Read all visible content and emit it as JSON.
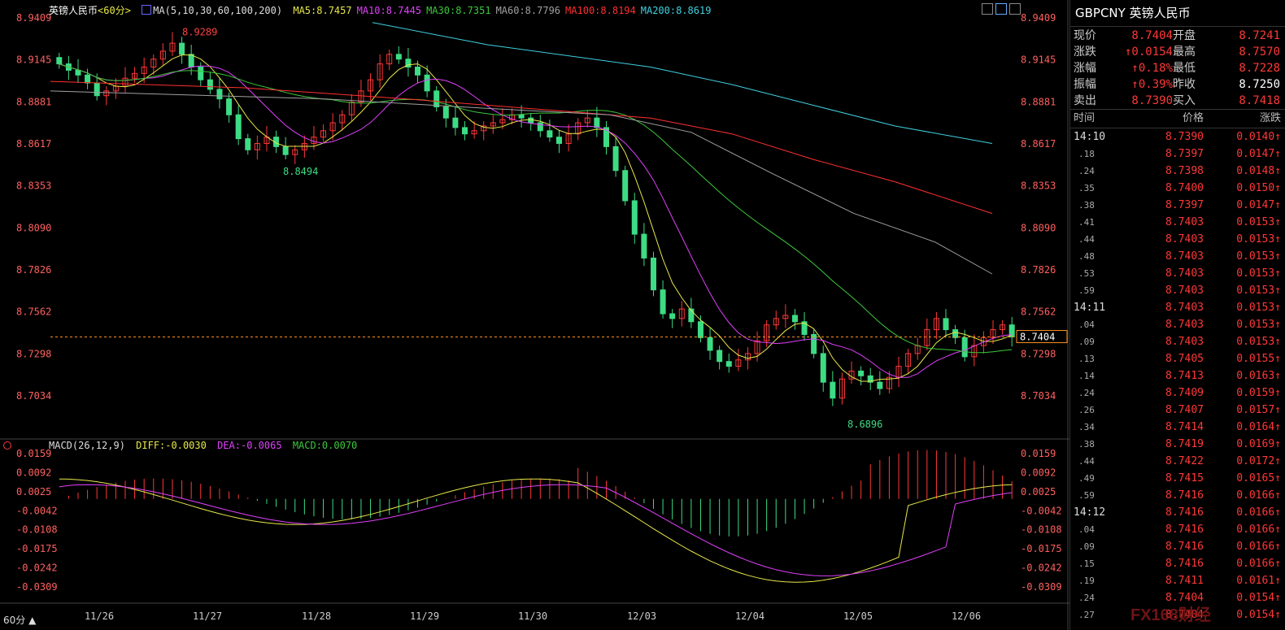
{
  "header": {
    "symbol_name": "英镑人民币",
    "period": "<60分>",
    "ma_icon": "chart-icon",
    "ma_label": "MA(5,10,30,60,100,200)",
    "ma_values": [
      {
        "text": "MA5:8.7457",
        "color": "#e8e84a"
      },
      {
        "text": "MA10:8.7445",
        "color": "#e040fb"
      },
      {
        "text": "MA30:8.7351",
        "color": "#3cc83c"
      },
      {
        "text": "MA60:8.7796",
        "color": "#a0a0a0"
      },
      {
        "text": "MA100:8.8194",
        "color": "#ff3030"
      },
      {
        "text": "MA200:8.8619",
        "color": "#40d0e0"
      }
    ]
  },
  "macd_header": {
    "label": "MACD(26,12,9)",
    "diff": "DIFF:-0.0030",
    "dea": "DEA:-0.0065",
    "macd": "MACD:0.0070"
  },
  "price_axis": [
    "8.9409",
    "8.9145",
    "8.8881",
    "8.8617",
    "8.8353",
    "8.8090",
    "8.7826",
    "8.7562",
    "8.7298",
    "8.7034"
  ],
  "current_price_tag": "8.7404",
  "macd_axis": [
    "0.0159",
    "0.0092",
    "0.0025",
    "-0.0042",
    "-0.0108",
    "-0.0175",
    "-0.0242",
    "-0.0309"
  ],
  "dates": [
    "11/26",
    "11/27",
    "11/28",
    "11/29",
    "11/30",
    "12/03",
    "12/04",
    "12/05",
    "12/06"
  ],
  "annotations": {
    "high": "8.9289",
    "low1": "8.8494",
    "low2": "8.6896"
  },
  "period_selector": "60分 ▲",
  "colors": {
    "up": "#ff3838",
    "down": "#3ddc84",
    "bg": "#000000",
    "grid": "#222222"
  },
  "panel": {
    "title": "GBPCNY 英镑人民币",
    "quote": [
      {
        "label": "现价",
        "value": "8.7404",
        "label2": "开盘",
        "value2": "8.7241"
      },
      {
        "label": "涨跌",
        "value": "↑0.0154",
        "label2": "最高",
        "value2": "8.7570"
      },
      {
        "label": "涨幅",
        "value": "↑0.18%",
        "label2": "最低",
        "value2": "8.7228"
      },
      {
        "label": "振幅",
        "value": "↑0.39%",
        "label2": "昨收",
        "value2": "8.7250"
      },
      {
        "label": "卖出",
        "value": "8.7390",
        "label2": "买入",
        "value2": "8.7418"
      }
    ],
    "ticks_header": {
      "time": "时间",
      "price": "价格",
      "change": "涨跌"
    },
    "ticks": [
      {
        "t": "14:10",
        "p": "8.7390",
        "c": "0.0140↑"
      },
      {
        "t": ".18",
        "p": "8.7397",
        "c": "0.0147↑"
      },
      {
        "t": ".24",
        "p": "8.7398",
        "c": "0.0148↑"
      },
      {
        "t": ".35",
        "p": "8.7400",
        "c": "0.0150↑"
      },
      {
        "t": ".38",
        "p": "8.7397",
        "c": "0.0147↑"
      },
      {
        "t": ".41",
        "p": "8.7403",
        "c": "0.0153↑"
      },
      {
        "t": ".44",
        "p": "8.7403",
        "c": "0.0153↑"
      },
      {
        "t": ".48",
        "p": "8.7403",
        "c": "0.0153↑"
      },
      {
        "t": ".53",
        "p": "8.7403",
        "c": "0.0153↑"
      },
      {
        "t": ".59",
        "p": "8.7403",
        "c": "0.0153↑"
      },
      {
        "t": "14:11",
        "p": "8.7403",
        "c": "0.0153↑"
      },
      {
        "t": ".04",
        "p": "8.7403",
        "c": "0.0153↑"
      },
      {
        "t": ".09",
        "p": "8.7403",
        "c": "0.0153↑"
      },
      {
        "t": ".13",
        "p": "8.7405",
        "c": "0.0155↑"
      },
      {
        "t": ".14",
        "p": "8.7413",
        "c": "0.0163↑"
      },
      {
        "t": ".24",
        "p": "8.7409",
        "c": "0.0159↑"
      },
      {
        "t": ".26",
        "p": "8.7407",
        "c": "0.0157↑"
      },
      {
        "t": ".34",
        "p": "8.7414",
        "c": "0.0164↑"
      },
      {
        "t": ".38",
        "p": "8.7419",
        "c": "0.0169↑"
      },
      {
        "t": ".44",
        "p": "8.7422",
        "c": "0.0172↑"
      },
      {
        "t": ".49",
        "p": "8.7415",
        "c": "0.0165↑"
      },
      {
        "t": ".59",
        "p": "8.7416",
        "c": "0.0166↑"
      },
      {
        "t": "14:12",
        "p": "8.7416",
        "c": "0.0166↑"
      },
      {
        "t": ".04",
        "p": "8.7416",
        "c": "0.0166↑"
      },
      {
        "t": ".09",
        "p": "8.7416",
        "c": "0.0166↑"
      },
      {
        "t": ".15",
        "p": "8.7416",
        "c": "0.0166↑"
      },
      {
        "t": ".19",
        "p": "8.7411",
        "c": "0.0161↑"
      },
      {
        "t": ".24",
        "p": "8.7404",
        "c": "0.0154↑"
      },
      {
        "t": ".27",
        "p": "8.7404",
        "c": "0.0154↑"
      }
    ]
  },
  "watermark": "FX168财经",
  "chart_data": {
    "type": "candlestick",
    "title": "英镑人民币 60分",
    "ylim": [
      8.6896,
      8.9409
    ],
    "x": [
      "11/26",
      "11/27",
      "11/28",
      "11/29",
      "11/30",
      "12/03",
      "12/04",
      "12/05",
      "12/06"
    ],
    "high": 8.9289,
    "low": 8.6896,
    "last": 8.7404,
    "ma": {
      "MA5": 8.7457,
      "MA10": 8.7445,
      "MA30": 8.7351,
      "MA60": 8.7796,
      "MA100": 8.8194,
      "MA200": 8.8619
    },
    "macd": {
      "DIFF": -0.003,
      "DEA": -0.0065,
      "MACD": 0.007,
      "ylim": [
        -0.0309,
        0.0159
      ]
    },
    "closes": [
      8.912,
      8.908,
      8.905,
      8.9,
      8.892,
      8.895,
      8.898,
      8.903,
      8.906,
      8.91,
      8.915,
      8.92,
      8.925,
      8.918,
      8.91,
      8.902,
      8.896,
      8.89,
      8.88,
      8.865,
      8.858,
      8.862,
      8.866,
      8.86,
      8.855,
      8.858,
      8.862,
      8.866,
      8.87,
      8.875,
      8.88,
      8.888,
      8.895,
      8.902,
      8.912,
      8.918,
      8.915,
      8.91,
      8.905,
      8.895,
      8.885,
      8.878,
      8.872,
      8.868,
      8.87,
      8.873,
      8.875,
      8.877,
      8.88,
      8.878,
      8.875,
      8.87,
      8.866,
      8.862,
      8.868,
      8.875,
      8.878,
      8.872,
      8.86,
      8.845,
      8.826,
      8.805,
      8.79,
      8.77,
      8.755,
      8.752,
      8.758,
      8.75,
      8.74,
      8.732,
      8.725,
      8.722,
      8.726,
      8.73,
      8.738,
      8.748,
      8.752,
      8.754,
      8.75,
      8.742,
      8.73,
      8.712,
      8.702,
      8.714,
      8.719,
      8.716,
      8.712,
      8.708,
      8.715,
      8.722,
      8.73,
      8.735,
      8.745,
      8.752,
      8.745,
      8.74,
      8.728,
      8.735,
      8.74,
      8.745,
      8.748,
      8.7404
    ]
  }
}
